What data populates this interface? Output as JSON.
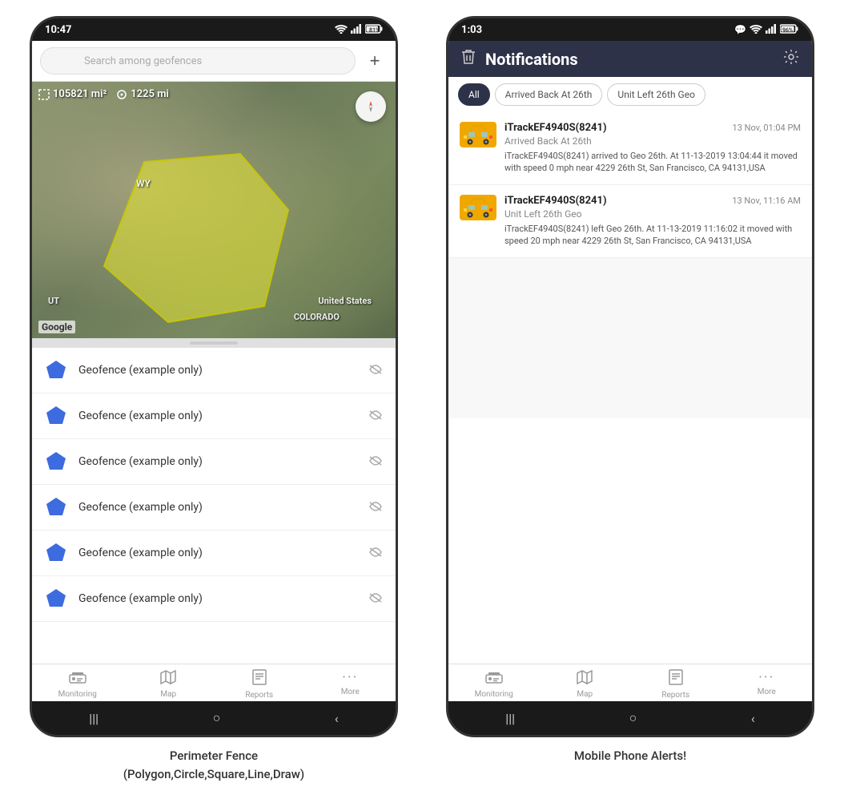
{
  "left_phone": {
    "status_bar": {
      "time": "10:47",
      "icons": "WiFi ▲ 81%"
    },
    "search": {
      "placeholder": "Search among geofences"
    },
    "map": {
      "area_stat": "105821 mi²",
      "distance_stat": "1225 mi",
      "label_us": "United States",
      "label_co": "COLORADO",
      "label_wy": "WY",
      "label_ut": "UT",
      "google": "Google"
    },
    "geofence_items": [
      {
        "name": "Geofence (example only)"
      },
      {
        "name": "Geofence (example only)"
      },
      {
        "name": "Geofence (example only)"
      },
      {
        "name": "Geofence (example only)"
      },
      {
        "name": "Geofence (example only)"
      },
      {
        "name": "Geofence (example only)"
      }
    ],
    "nav": {
      "items": [
        {
          "label": "Monitoring",
          "icon": "🚌"
        },
        {
          "label": "Map",
          "icon": "🗺"
        },
        {
          "label": "Reports",
          "icon": "📊"
        },
        {
          "label": "More",
          "icon": "···"
        }
      ]
    },
    "caption": "Perimeter Fence\n(Polygon,Circle,Square,Line,Draw)"
  },
  "right_phone": {
    "status_bar": {
      "time": "1:03",
      "icons": "💬 WiFi ▲ 96%"
    },
    "header": {
      "title": "Notifications",
      "delete_icon": "🗑",
      "settings_icon": "⚙"
    },
    "filter_tabs": [
      {
        "label": "All",
        "active": true
      },
      {
        "label": "Arrived Back At 26th",
        "active": false
      },
      {
        "label": "Unit Left 26th Geo",
        "active": false
      }
    ],
    "notifications": [
      {
        "device": "iTrackEF4940S(8241)",
        "time": "13 Nov, 01:04 PM",
        "event": "Arrived Back At 26th",
        "body": "iTrackEF4940S(8241) arrived to Geo 26th.   At 11-13-2019 13:04:44 it moved with speed 0 mph near 4229 26th St, San Francisco, CA 94131,USA"
      },
      {
        "device": "iTrackEF4940S(8241)",
        "time": "13 Nov, 11:16 AM",
        "event": "Unit Left 26th Geo",
        "body": "iTrackEF4940S(8241) left Geo 26th.   At 11-13-2019 11:16:02 it moved with speed 20 mph near 4229 26th St, San Francisco, CA 94131,USA"
      }
    ],
    "nav": {
      "items": [
        {
          "label": "Monitoring",
          "icon": "🚌"
        },
        {
          "label": "Map",
          "icon": "🗺"
        },
        {
          "label": "Reports",
          "icon": "📊"
        },
        {
          "label": "More",
          "icon": "···"
        }
      ]
    },
    "caption": "Mobile Phone Alerts!"
  }
}
